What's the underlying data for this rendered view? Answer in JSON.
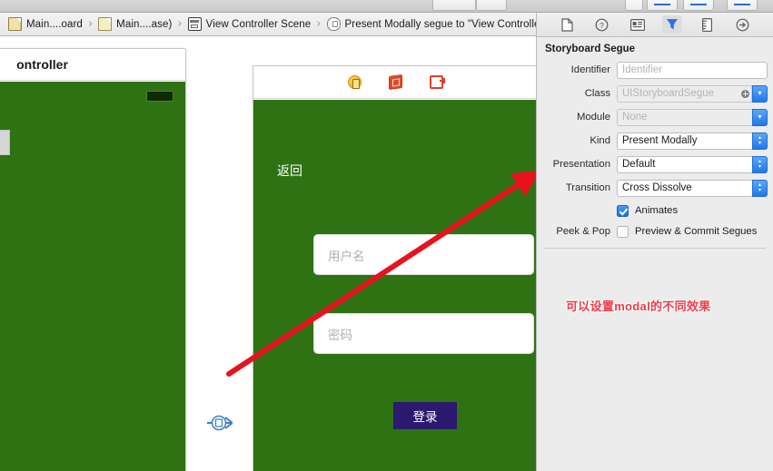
{
  "window": {
    "toolbar_segments": [
      "seg-1",
      "seg-2",
      "seg-3"
    ]
  },
  "jumpbar": {
    "crumbs": [
      {
        "icon": "storyboard-file-icon",
        "label": "Main....oard"
      },
      {
        "icon": "storyboard-file-icon",
        "label": "Main....ase)"
      },
      {
        "icon": "scene-icon",
        "label": "View Controller Scene"
      },
      {
        "icon": "segue-icon",
        "label": "Present Modally segue to \"View Controller\""
      }
    ],
    "separator": "›"
  },
  "inspector": {
    "tabs": [
      {
        "name": "file-inspector-tab",
        "icon": "document-icon",
        "selected": false
      },
      {
        "name": "quick-help-inspector-tab",
        "icon": "question-circle-icon",
        "selected": false
      },
      {
        "name": "identity-inspector-tab",
        "icon": "id-card-icon",
        "selected": false
      },
      {
        "name": "attributes-inspector-tab",
        "icon": "attributes-slider-icon",
        "selected": true
      },
      {
        "name": "size-inspector-tab",
        "icon": "ruler-icon",
        "selected": false
      },
      {
        "name": "connections-inspector-tab",
        "icon": "arrow-circle-icon",
        "selected": false
      }
    ],
    "section_title": "Storyboard Segue",
    "fields": [
      {
        "label": "Identifier",
        "value": "",
        "placeholder": "Identifier",
        "type": "text",
        "enabled": true
      },
      {
        "label": "Class",
        "value": "",
        "placeholder": "UIStoryboardSegue",
        "type": "class-combo",
        "enabled": false
      },
      {
        "label": "Module",
        "value": "",
        "placeholder": "None",
        "type": "combo",
        "enabled": false
      },
      {
        "label": "Kind",
        "value": "Present Modally",
        "placeholder": "",
        "type": "popup",
        "enabled": true
      },
      {
        "label": "Presentation",
        "value": "Default",
        "placeholder": "",
        "type": "popup",
        "enabled": true
      },
      {
        "label": "Transition",
        "value": "Cross Dissolve",
        "placeholder": "",
        "type": "popup",
        "enabled": true
      }
    ],
    "checkboxes": [
      {
        "label_left": "",
        "label": "Animates",
        "checked": true
      },
      {
        "label_left": "Peek & Pop",
        "label": "Preview & Commit Segues",
        "checked": false
      }
    ]
  },
  "annotation": {
    "text": "可以设置modal的不同效果",
    "color": "#ef3b49"
  },
  "canvas": {
    "left_scene": {
      "title": "ontroller",
      "background_color": "#2f7214"
    },
    "right_scene": {
      "dock_icons": [
        {
          "name": "view-controller-dock-icon"
        },
        {
          "name": "first-responder-dock-icon"
        },
        {
          "name": "exit-dock-icon"
        }
      ],
      "background_color": "#2f7214",
      "back_label": "返回",
      "username_field_placeholder": "用户名",
      "password_field_placeholder": "密码",
      "login_button_label": "登录",
      "login_button_color": "#2b1a70"
    },
    "segue_badge": {
      "name": "modal-segue-badge"
    },
    "red_arrow": {
      "name": "annotation-arrow",
      "color": "#e8121f"
    }
  }
}
